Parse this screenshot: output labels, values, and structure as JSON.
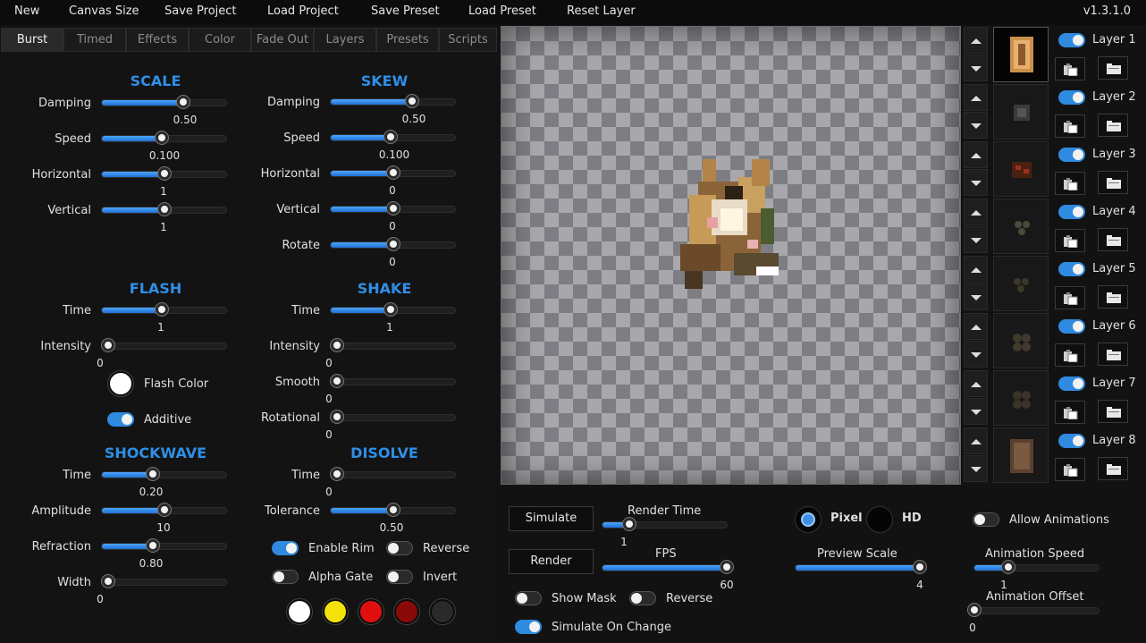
{
  "menu": [
    "New",
    "Canvas Size",
    "Save Project",
    "Load Project",
    "Save Preset",
    "Load Preset",
    "Reset Layer"
  ],
  "version": "v1.3.1.0",
  "tabs": [
    "Burst",
    "Timed",
    "Effects",
    "Color",
    "Fade Out",
    "Layers",
    "Presets",
    "Scripts"
  ],
  "active_tab": "Burst",
  "scale": {
    "title": "SCALE",
    "damping": {
      "label": "Damping",
      "value": "0.50",
      "level": 0.67
    },
    "speed": {
      "label": "Speed",
      "value": "0.100",
      "level": 0.48
    },
    "horizontal": {
      "label": "Horizontal",
      "value": "1",
      "level": 0.5
    },
    "vertical": {
      "label": "Vertical",
      "value": "1",
      "level": 0.5
    }
  },
  "skew": {
    "title": "SKEW",
    "damping": {
      "label": "Damping",
      "value": "0.50",
      "level": 0.67
    },
    "speed": {
      "label": "Speed",
      "value": "0.100",
      "level": 0.48
    },
    "horizontal": {
      "label": "Horizontal",
      "value": "0",
      "level": 0.5
    },
    "vertical": {
      "label": "Vertical",
      "value": "0",
      "level": 0.5
    },
    "rotate": {
      "label": "Rotate",
      "value": "0",
      "level": 0.5
    }
  },
  "flash": {
    "title": "FLASH",
    "time": {
      "label": "Time",
      "value": "1",
      "level": 0.48
    },
    "intensity": {
      "label": "Intensity",
      "value": "0",
      "level": 0
    },
    "flash_color_label": "Flash Color",
    "additive_label": "Additive",
    "additive_on": true
  },
  "shake": {
    "title": "SHAKE",
    "time": {
      "label": "Time",
      "value": "1",
      "level": 0.48
    },
    "intensity": {
      "label": "Intensity",
      "value": "0",
      "level": 0
    },
    "smooth": {
      "label": "Smooth",
      "value": "0",
      "level": 0
    },
    "rotational": {
      "label": "Rotational",
      "value": "0",
      "level": 0
    }
  },
  "shockwave": {
    "title": "SHOCKWAVE",
    "time": {
      "label": "Time",
      "value": "0.20",
      "level": 0.4
    },
    "amplitude": {
      "label": "Amplitude",
      "value": "10",
      "level": 0.5
    },
    "refraction": {
      "label": "Refraction",
      "value": "0.80",
      "level": 0.4
    },
    "width": {
      "label": "Width",
      "value": "0",
      "level": 0
    }
  },
  "disolve": {
    "title": "DISOLVE",
    "time": {
      "label": "Time",
      "value": "0",
      "level": 0
    },
    "tolerance": {
      "label": "Tolerance",
      "value": "0.50",
      "level": 0.5
    }
  },
  "toggles": {
    "enable_rim": {
      "label": "Enable Rim",
      "on": true
    },
    "reverse": {
      "label": "Reverse",
      "on": false
    },
    "alpha_gate": {
      "label": "Alpha Gate",
      "on": false
    },
    "invert": {
      "label": "Invert",
      "on": false
    }
  },
  "swatches": [
    "#ffffff",
    "#f5e20a",
    "#e01010",
    "#8a0a0a",
    "#2a2a2a"
  ],
  "bottom": {
    "simulate_label": "Simulate",
    "render_label": "Render",
    "render_time": {
      "label": "Render Time",
      "value": "1",
      "level": 0.18
    },
    "fps": {
      "label": "FPS",
      "value": "60",
      "level": 1.0
    },
    "show_mask": {
      "label": "Show Mask",
      "on": false
    },
    "reverse": {
      "label": "Reverse",
      "on": false
    },
    "simulate_on_change": {
      "label": "Simulate On Change",
      "on": true
    },
    "pixel_label": "Pixel",
    "hd_label": "HD",
    "preview_scale": {
      "label": "Preview Scale",
      "value": "4",
      "level": 1.0
    },
    "allow_animations": {
      "label": "Allow Animations",
      "on": false
    },
    "animation_speed": {
      "label": "Animation Speed",
      "value": "1",
      "level": 0.25
    },
    "animation_offset": {
      "label": "Animation Offset",
      "value": "0",
      "level": 0
    }
  },
  "layers": [
    {
      "name": "Layer 1",
      "on": true
    },
    {
      "name": "Layer 2",
      "on": true
    },
    {
      "name": "Layer 3",
      "on": true
    },
    {
      "name": "Layer 4",
      "on": true
    },
    {
      "name": "Layer 5",
      "on": true
    },
    {
      "name": "Layer 6",
      "on": true
    },
    {
      "name": "Layer 7",
      "on": true
    },
    {
      "name": "Layer 8",
      "on": true
    }
  ],
  "icons": {
    "up": "arrow-up-icon",
    "down": "arrow-down-icon",
    "paste": "paste-icon",
    "folder": "folder-icon"
  }
}
